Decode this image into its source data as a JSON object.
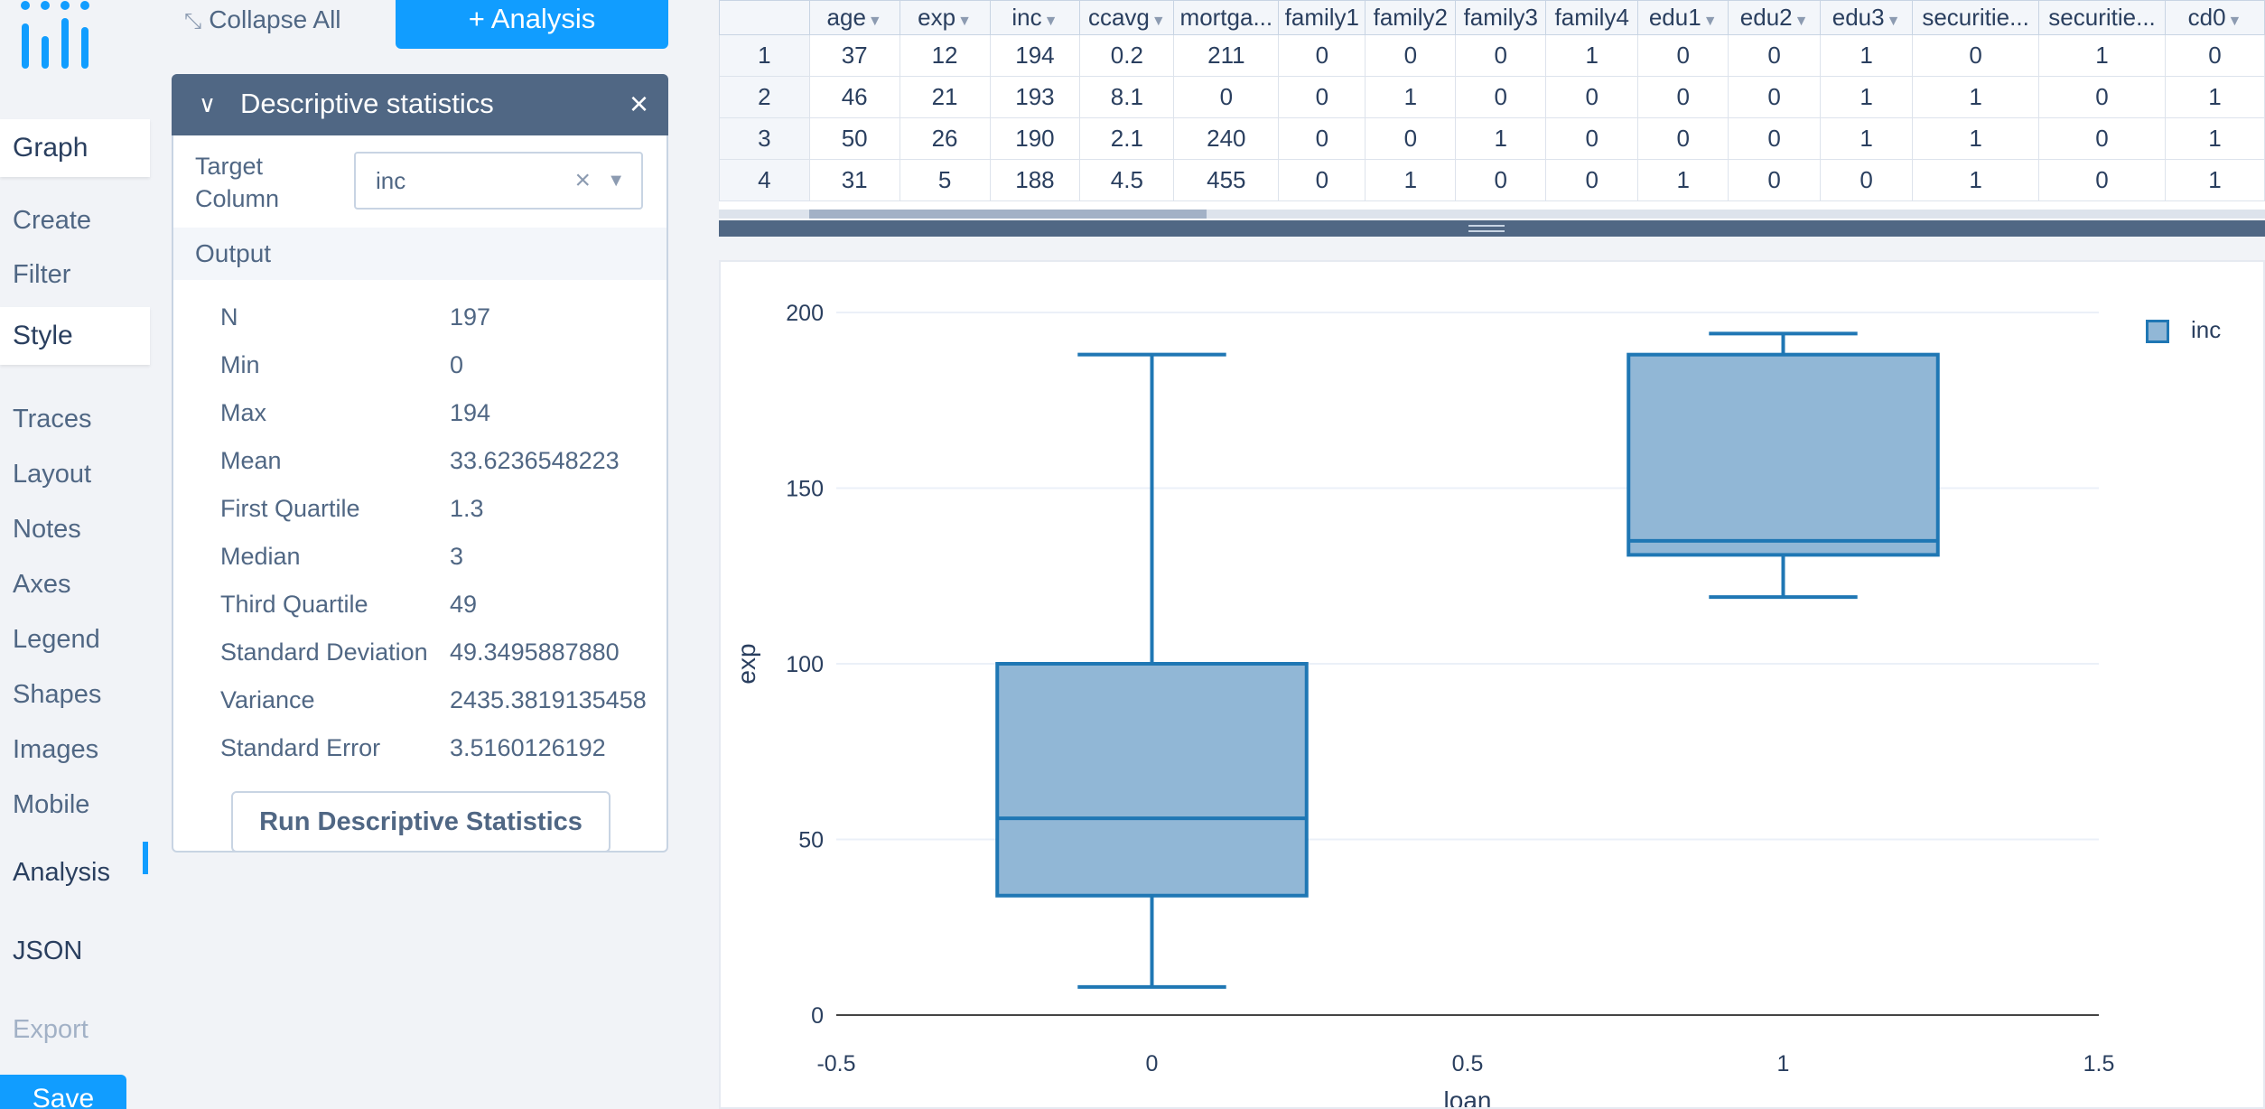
{
  "nav": {
    "graph_label": "Graph",
    "graph_items": [
      "Create",
      "Filter"
    ],
    "style_label": "Style",
    "style_items": [
      "Traces",
      "Layout",
      "Notes",
      "Axes",
      "Legend",
      "Shapes",
      "Images",
      "Mobile"
    ],
    "analysis_label": "Analysis",
    "json_label": "JSON",
    "export_label": "Export",
    "save_label": "Save",
    "accent": "#119dff"
  },
  "panel": {
    "collapse_all": "Collapse All",
    "add_analysis": "+ Analysis",
    "card_title": "Descriptive statistics",
    "target_label": "Target Column",
    "target_value": "inc",
    "output_label": "Output",
    "stats": [
      {
        "label": "N",
        "value": "197"
      },
      {
        "label": "Min",
        "value": "0"
      },
      {
        "label": "Max",
        "value": "194"
      },
      {
        "label": "Mean",
        "value": "33.6236548223"
      },
      {
        "label": "First Quartile",
        "value": "1.3"
      },
      {
        "label": "Median",
        "value": "3"
      },
      {
        "label": "Third Quartile",
        "value": "49"
      },
      {
        "label": "Standard Deviation",
        "value": "49.3495887880"
      },
      {
        "label": "Variance",
        "value": "2435.3819135458"
      },
      {
        "label": "Standard Error",
        "value": "3.5160126192"
      }
    ],
    "run_button": "Run Descriptive Statistics"
  },
  "grid": {
    "columns": [
      "age",
      "exp",
      "inc",
      "ccavg",
      "mortga...",
      "family1",
      "family2",
      "family3",
      "family4",
      "edu1",
      "edu2",
      "edu3",
      "securitie...",
      "securitie...",
      "cd0"
    ],
    "rows": [
      {
        "n": "1",
        "cells": [
          "37",
          "12",
          "194",
          "0.2",
          "211",
          "0",
          "0",
          "0",
          "1",
          "0",
          "0",
          "1",
          "0",
          "1",
          "0"
        ]
      },
      {
        "n": "2",
        "cells": [
          "46",
          "21",
          "193",
          "8.1",
          "0",
          "0",
          "1",
          "0",
          "0",
          "0",
          "0",
          "1",
          "1",
          "0",
          "1"
        ]
      },
      {
        "n": "3",
        "cells": [
          "50",
          "26",
          "190",
          "2.1",
          "240",
          "0",
          "0",
          "1",
          "0",
          "0",
          "0",
          "1",
          "1",
          "0",
          "1"
        ]
      },
      {
        "n": "4",
        "cells": [
          "31",
          "5",
          "188",
          "4.5",
          "455",
          "0",
          "1",
          "0",
          "0",
          "1",
          "0",
          "0",
          "1",
          "0",
          "1"
        ]
      }
    ]
  },
  "chart_data": {
    "type": "box",
    "xlabel": "loan",
    "ylabel": "exp",
    "xlim": [
      -0.5,
      1.5
    ],
    "ylim": [
      0,
      200
    ],
    "x_ticks": [
      "-0.5",
      "0",
      "0.5",
      "1",
      "1.5"
    ],
    "x_tick_values": [
      -0.5,
      0,
      0.5,
      1,
      1.5
    ],
    "y_ticks": [
      "0",
      "50",
      "100",
      "150",
      "200"
    ],
    "y_tick_values": [
      0,
      50,
      100,
      150,
      200
    ],
    "legend": [
      "inc"
    ],
    "legend_position": "top-right",
    "grid": true,
    "fill_color": "#91b7d6",
    "line_color": "#1f77b4",
    "series": [
      {
        "name": "inc",
        "boxes": [
          {
            "x": 0,
            "min": 8,
            "q1": 34,
            "median": 56,
            "q3": 100,
            "max": 188
          },
          {
            "x": 1,
            "min": 119,
            "q1": 131,
            "median": 135,
            "q3": 188,
            "max": 194
          }
        ]
      }
    ]
  }
}
